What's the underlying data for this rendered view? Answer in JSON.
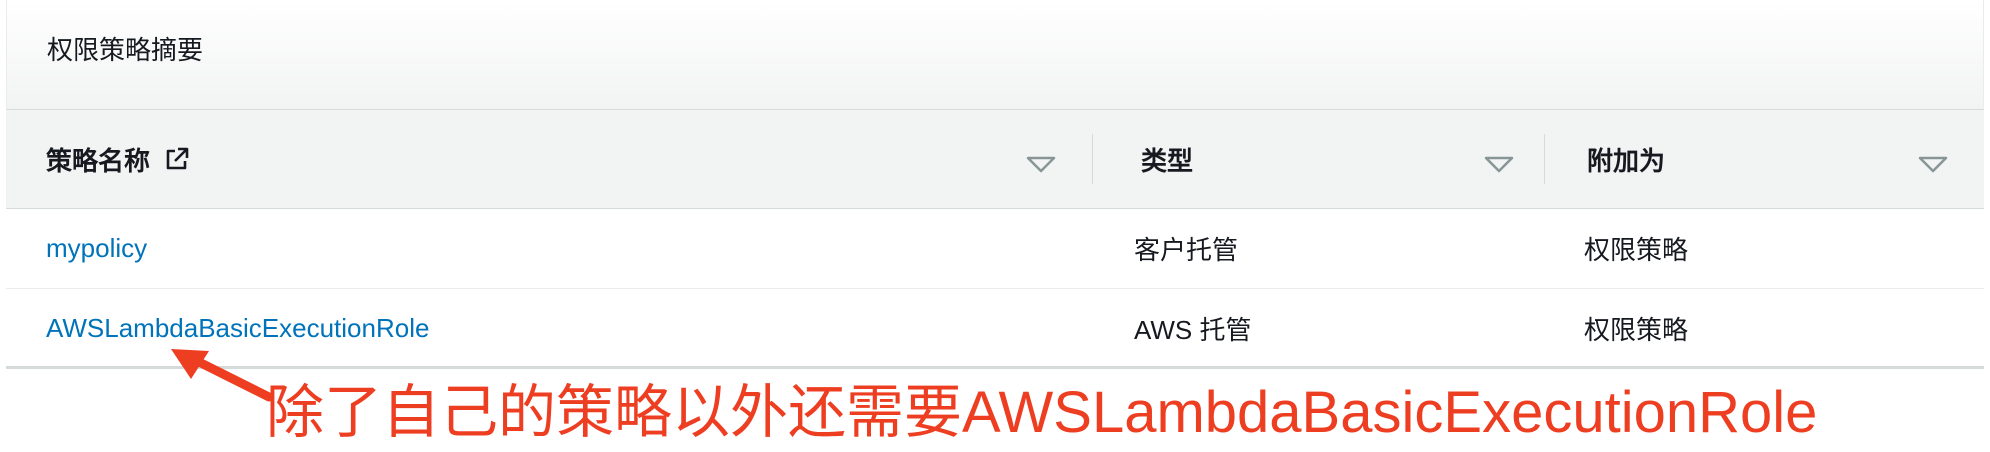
{
  "panel": {
    "title": "权限策略摘要"
  },
  "table": {
    "columns": [
      {
        "label": "策略名称",
        "external_link_icon": "external-link-icon",
        "sort_icon": "sort-down-triangle-icon"
      },
      {
        "label": "类型",
        "sort_icon": "sort-down-triangle-icon"
      },
      {
        "label": "附加为",
        "sort_icon": "sort-down-triangle-icon"
      }
    ],
    "rows": [
      {
        "name": "mypolicy",
        "type": "客户托管",
        "attached_as": "权限策略"
      },
      {
        "name": "AWSLambdaBasicExecutionRole",
        "type": "AWS 托管",
        "attached_as": "权限策略"
      }
    ]
  },
  "annotation": {
    "text": "除了自己的策略以外还需要AWSLambdaBasicExecutionRole",
    "color": "#ee3e22"
  },
  "colors": {
    "link": "#0073bb",
    "header_bg": "#f2f3f3",
    "border": "#d5dbdb",
    "annotation": "#ee3e22"
  }
}
